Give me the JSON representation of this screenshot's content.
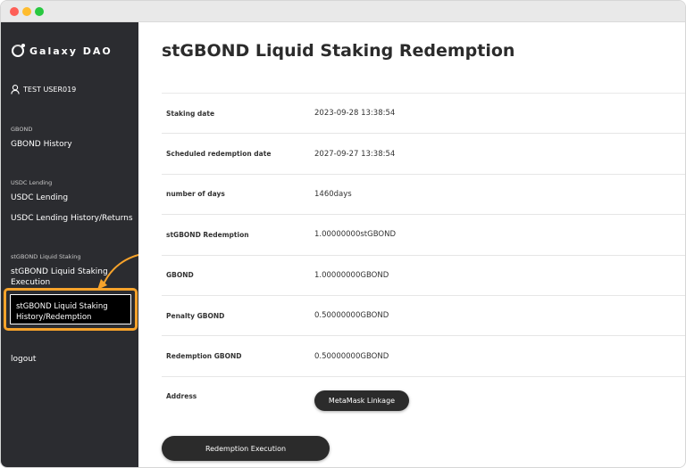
{
  "brand": {
    "name": "Galaxy DAO"
  },
  "user": {
    "name": "TEST USER019"
  },
  "sidebar": {
    "sections": [
      {
        "label": "GBOND",
        "items": [
          {
            "label": "GBOND History"
          }
        ]
      },
      {
        "label": "USDC Lending",
        "items": [
          {
            "label": "USDC Lending"
          },
          {
            "label": "USDC Lending History/Returns"
          }
        ]
      },
      {
        "label": "stGBOND Liquid Staking",
        "items": [
          {
            "label": "stGBOND Liquid Staking Execution"
          },
          {
            "label": "stGBOND Liquid Staking History/Redemption"
          }
        ]
      }
    ],
    "logout": "logout"
  },
  "main": {
    "title": "stGBOND Liquid Staking Redemption",
    "rows": [
      {
        "label": "Staking date",
        "value": "2023-09-28 13:38:54"
      },
      {
        "label": "Scheduled redemption date",
        "value": "2027-09-27 13:38:54"
      },
      {
        "label": "number of days",
        "value": "1460days"
      },
      {
        "label": "stGBOND Redemption",
        "value": "1.00000000stGBOND"
      },
      {
        "label": "GBOND",
        "value": "1.00000000GBOND"
      },
      {
        "label": "Penalty GBOND",
        "value": "0.50000000GBOND"
      },
      {
        "label": "Redemption GBOND",
        "value": "0.50000000GBOND"
      },
      {
        "label": "Address",
        "value": ""
      }
    ],
    "metamask_button": "MetaMask Linkage",
    "redeem_button": "Redemption Execution"
  },
  "colors": {
    "sidebar_bg": "#2b2c30",
    "highlight": "#f7a32b",
    "button_bg": "#2b2b2b"
  }
}
